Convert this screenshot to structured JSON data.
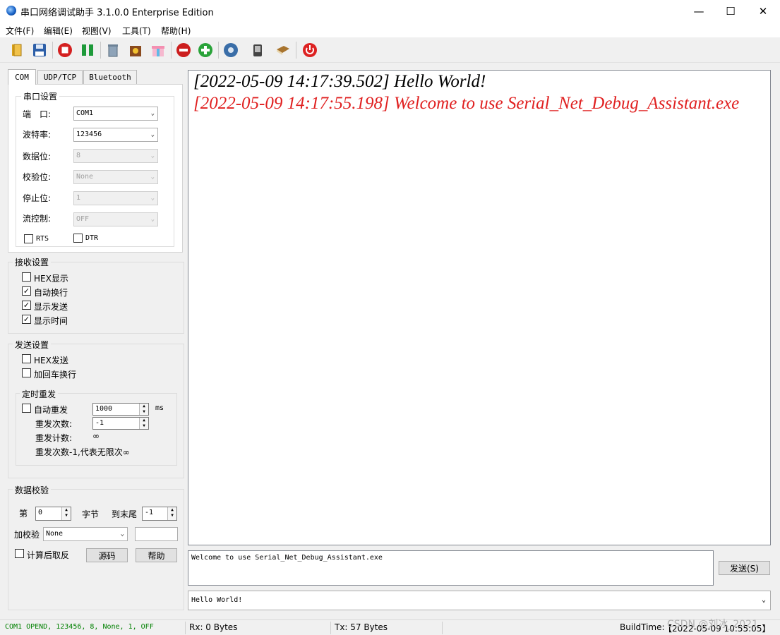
{
  "window": {
    "title": "串口网络调试助手 3.1.0.0 Enterprise Edition",
    "minimize": "—",
    "maximize": "☐",
    "close": "✕"
  },
  "menu": [
    "文件(F)",
    "编辑(E)",
    "视图(V)",
    "工具(T)",
    "帮助(H)"
  ],
  "tabs": [
    "COM",
    "UDP/TCP",
    "Bluetooth"
  ],
  "serial": {
    "group_title": "串口设置",
    "port_label": "端　口:",
    "port_value": "COM1",
    "baud_label": "波特率:",
    "baud_value": "123456",
    "databits_label": "数据位:",
    "databits_value": "8",
    "parity_label": "校验位:",
    "parity_value": "None",
    "stopbits_label": "停止位:",
    "stopbits_value": "1",
    "flow_label": "流控制:",
    "flow_value": "OFF",
    "rts_label": "RTS",
    "dtr_label": "DTR"
  },
  "receive_settings": {
    "title": "接收设置",
    "hex_display": "HEX显示",
    "auto_newline": "自动换行",
    "show_send": "显示发送",
    "show_time": "显示时间",
    "check_mark": "✓"
  },
  "send_settings": {
    "title": "发送设置",
    "hex_send": "HEX发送",
    "add_cr": "加回车换行",
    "timer_title": "定时重发",
    "auto_resend": "自动重发",
    "interval_value": "1000",
    "interval_unit": "ms",
    "resend_count_label": "重发次数:",
    "resend_count_value": "-1",
    "resend_counter_label": "重发计数:",
    "resend_counter_value": "∞",
    "note": "重发次数-1,代表无限次∞"
  },
  "checksum": {
    "title": "数据校验",
    "from_label": "第",
    "from_value": "0",
    "byte_label": "字节",
    "to_label": "到末尾",
    "to_value": "-1",
    "add_label": "加校验",
    "add_value": "None",
    "invert_label": "计算后取反",
    "source_button": "源码",
    "help_button": "帮助"
  },
  "receive_lines": [
    {
      "text": "[2022-05-09 14:17:39.502] Hello World!",
      "color": "#000000"
    },
    {
      "text": "[2022-05-09 14:17:55.198] Welcome to use Serial_Net_Debug_Assistant.exe",
      "color": "#e02020"
    }
  ],
  "send_text": "Welcome to use Serial_Net_Debug_Assistant.exe",
  "send_button": "发送(S)",
  "history_value": "Hello World!",
  "status": {
    "port_status": "COM1 OPEND, 123456, 8, None, 1, OFF",
    "rx": "Rx: 0 Bytes",
    "tx": "Tx: 57 Bytes",
    "build_label": "BuildTime:",
    "build_value": "【2022-05-09 10:55:05】",
    "watermark": "CSDN @刘冰_2021"
  },
  "colors": {
    "status_green": "#008000",
    "recv_red": "#e02020"
  }
}
